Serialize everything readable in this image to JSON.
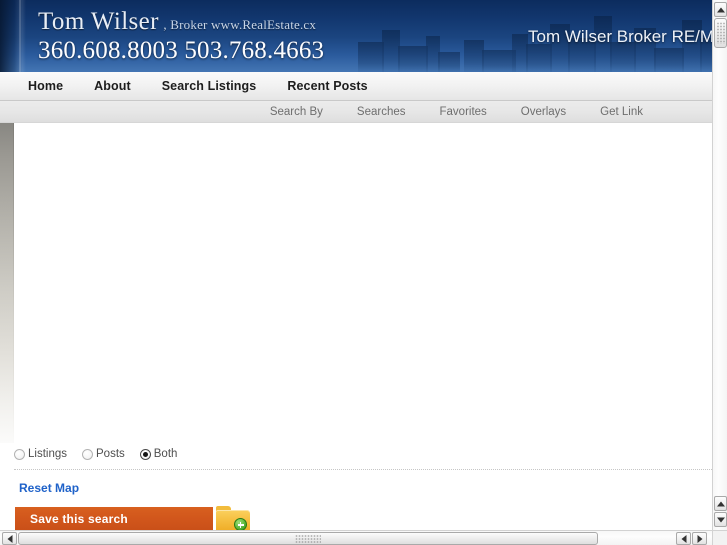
{
  "header": {
    "brand_name": "Tom Wilser",
    "brand_sub": ", Broker www.RealEstate.cx",
    "phones": "360.608.8003 503.768.4663",
    "right_title": "Tom Wilser Broker RE/MA",
    "gradient_top": "#0c2c5e",
    "gradient_bottom": "#4476b4"
  },
  "nav_primary": {
    "items": [
      {
        "label": "Home"
      },
      {
        "label": "About"
      },
      {
        "label": "Search Listings"
      },
      {
        "label": "Recent Posts"
      }
    ]
  },
  "nav_secondary": {
    "items": [
      {
        "label": "Search By"
      },
      {
        "label": "Searches"
      },
      {
        "label": "Favorites"
      },
      {
        "label": "Overlays"
      },
      {
        "label": "Get Link"
      }
    ]
  },
  "map": {
    "background_color": "#ffffff"
  },
  "controls": {
    "radio_group_name": "result-type",
    "radios": [
      {
        "label": "Listings",
        "checked": false
      },
      {
        "label": "Posts",
        "checked": false
      },
      {
        "label": "Both",
        "checked": true
      }
    ],
    "reset_map_label": "Reset Map",
    "reset_map_color": "#1f62c9",
    "save_search_label": "Save this search",
    "save_search_color": "#d2571c",
    "folder_icon": "folder-add-icon",
    "folder_color": "#f6c043",
    "badge_color": "#5cb73a"
  },
  "scrollbars": {
    "vertical_icon_up": "scroll-up-arrow-icon",
    "vertical_icon_down": "scroll-down-arrow-icon",
    "horizontal_icon_left": "scroll-left-arrow-icon",
    "horizontal_icon_right": "scroll-right-arrow-icon"
  }
}
